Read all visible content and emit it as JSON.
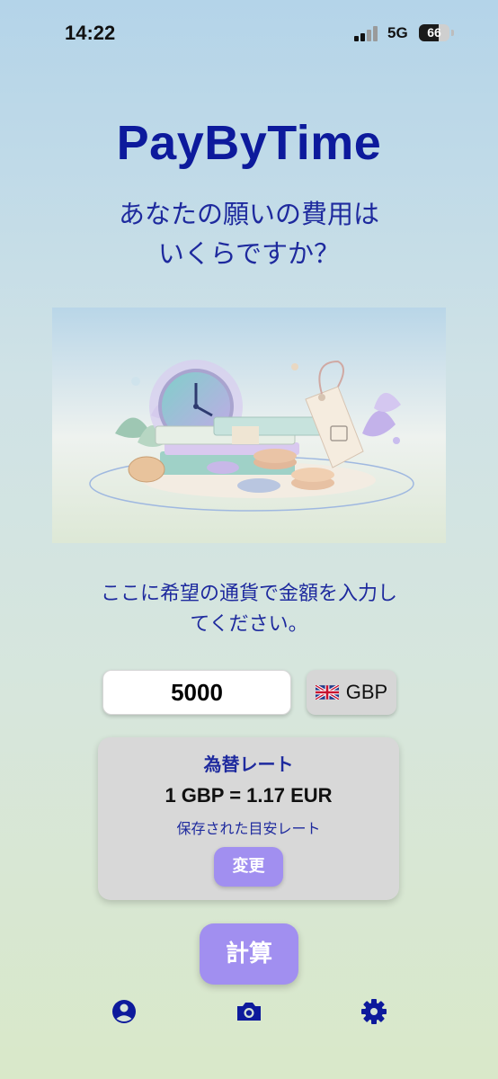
{
  "status_bar": {
    "time": "14:22",
    "network": "5G",
    "battery": "66",
    "battery_level": 0.66
  },
  "app": {
    "title": "PayByTime",
    "headline_line1": "あなたの願いの費用は",
    "headline_line2": "いくらですか？"
  },
  "prompt": {
    "line1": "ここに希望の通貨で金額を入力し",
    "line2": "てください。"
  },
  "amount_input": {
    "value": "5000"
  },
  "currency_selector": {
    "code": "GBP",
    "flag_icon": "uk-flag-icon"
  },
  "exchange_rate": {
    "title": "為替レート",
    "rate": "1 GBP = 1.17 EUR",
    "note": "保存された目安レート",
    "change_label": "変更"
  },
  "calculate_label": "計算",
  "tab_bar": [
    {
      "id": "profile",
      "icon": "user-circle-icon"
    },
    {
      "id": "camera",
      "icon": "camera-icon"
    },
    {
      "id": "settings",
      "icon": "gear-icon"
    }
  ],
  "colors": {
    "brand": "#0d1a9c",
    "text_accent": "#1e2a9e",
    "button": "#a18ff0",
    "card": "#d8d8d8"
  }
}
